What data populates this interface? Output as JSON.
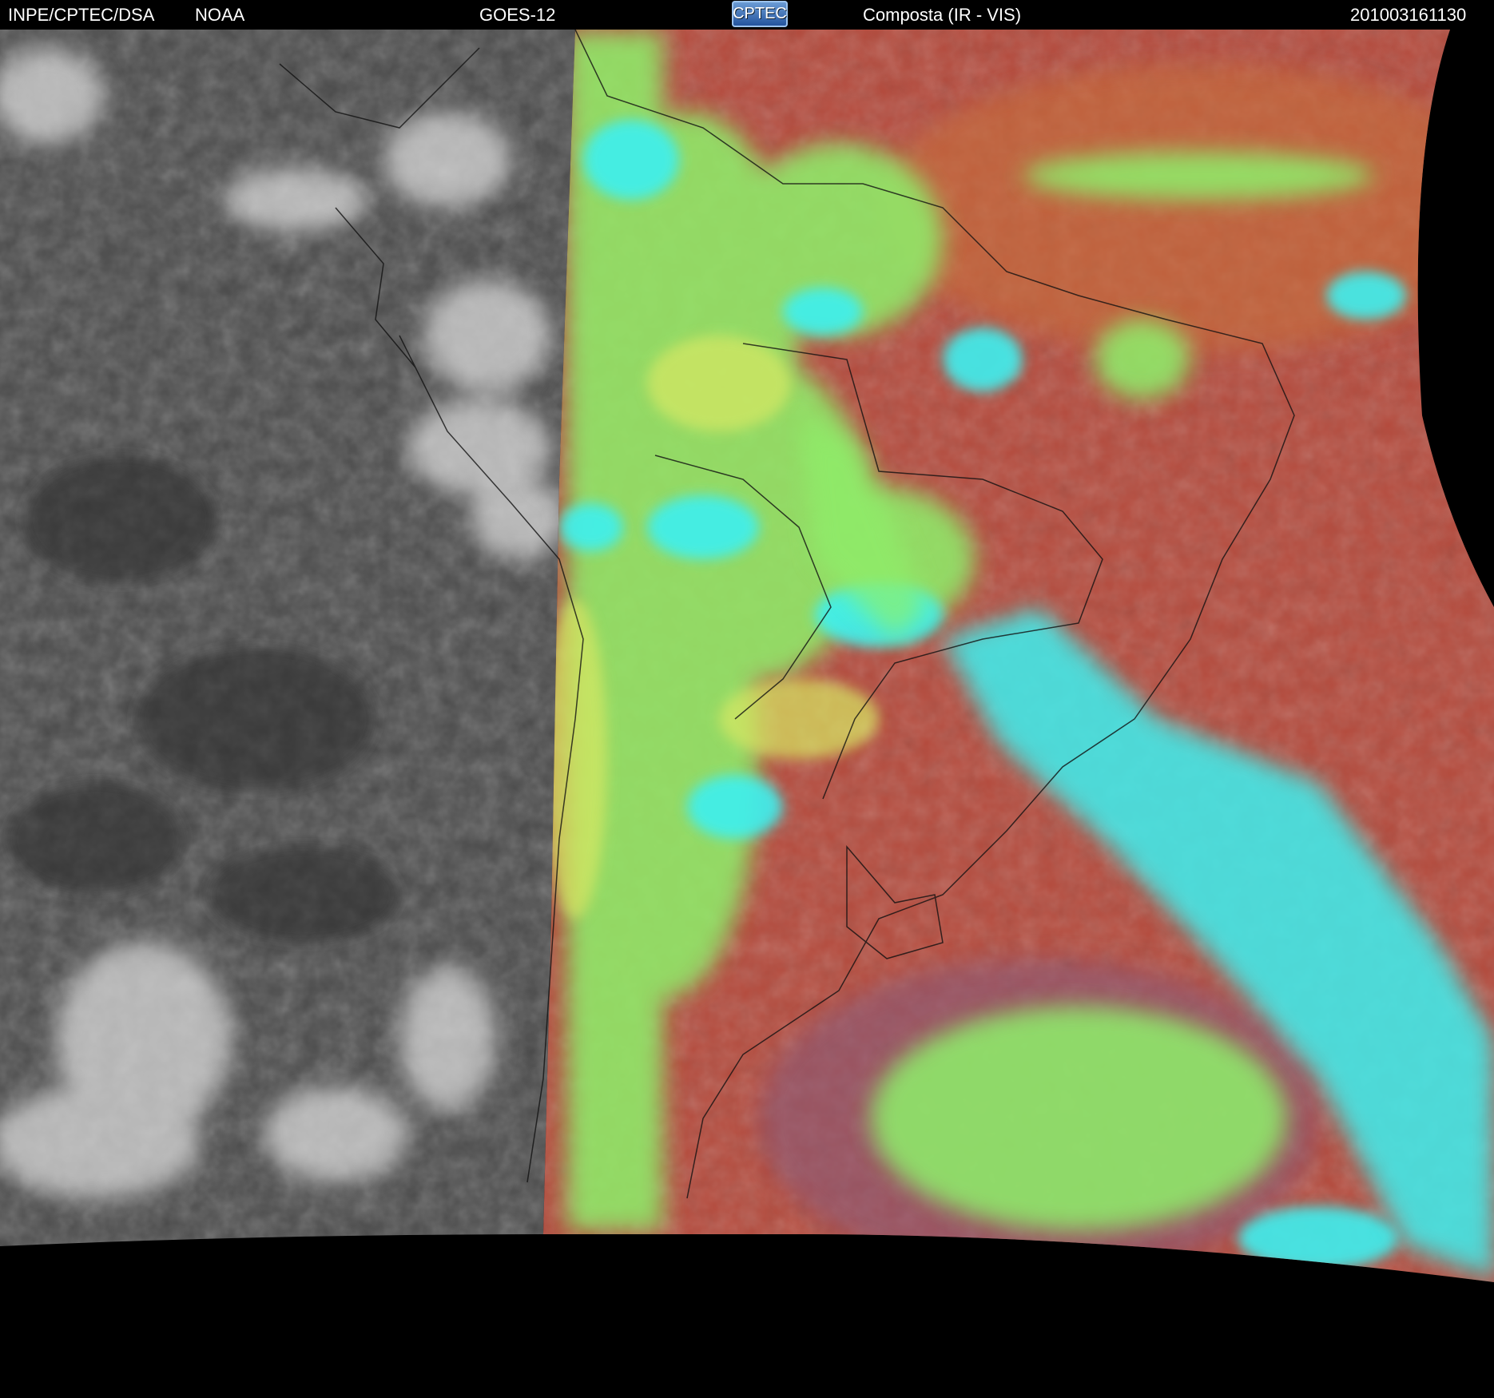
{
  "header": {
    "agency": "INPE/CPTEC/DSA",
    "source": "NOAA",
    "satellite": "GOES-12",
    "logo_text": "CPTEC",
    "product": "Composta (IR - VIS)",
    "timestamp": "201003161130"
  },
  "colors": {
    "background": "#000000",
    "night_ir_gray": "#4a4a4a",
    "composite_clear": "#b44a3c",
    "cloud_cyan": "#3ef0f0",
    "cloud_green": "#8ef06a",
    "cloud_yellow": "#d8e864"
  }
}
